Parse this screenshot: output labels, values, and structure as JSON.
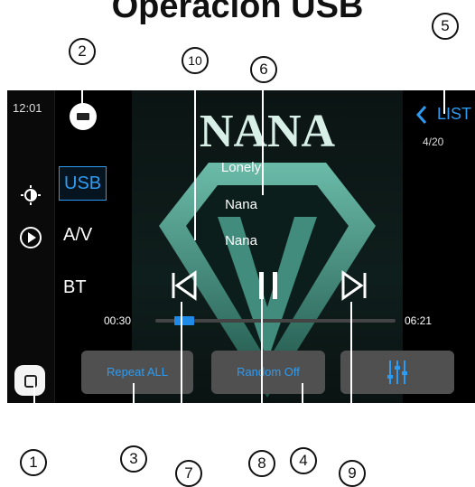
{
  "page_title": "Operación USB",
  "screen": {
    "clock": "12:01",
    "sources": [
      {
        "label": "USB",
        "active": true
      },
      {
        "label": "A/V",
        "active": false
      },
      {
        "label": "BT",
        "active": false
      }
    ],
    "album_text": "NANA",
    "track": {
      "title": "Lonely",
      "artist": "Nana",
      "album": "Nana"
    },
    "time_elapsed": "00:30",
    "time_total": "06:21",
    "progress_fraction": 0.08,
    "list_label": "LIST",
    "track_counter": "4/20",
    "buttons": {
      "repeat": "Repeat ALL",
      "random": "Random Off"
    },
    "accent_color": "#2e9bf0"
  },
  "callouts": [
    "1",
    "2",
    "3",
    "4",
    "5",
    "6",
    "7",
    "8",
    "9",
    "10"
  ]
}
